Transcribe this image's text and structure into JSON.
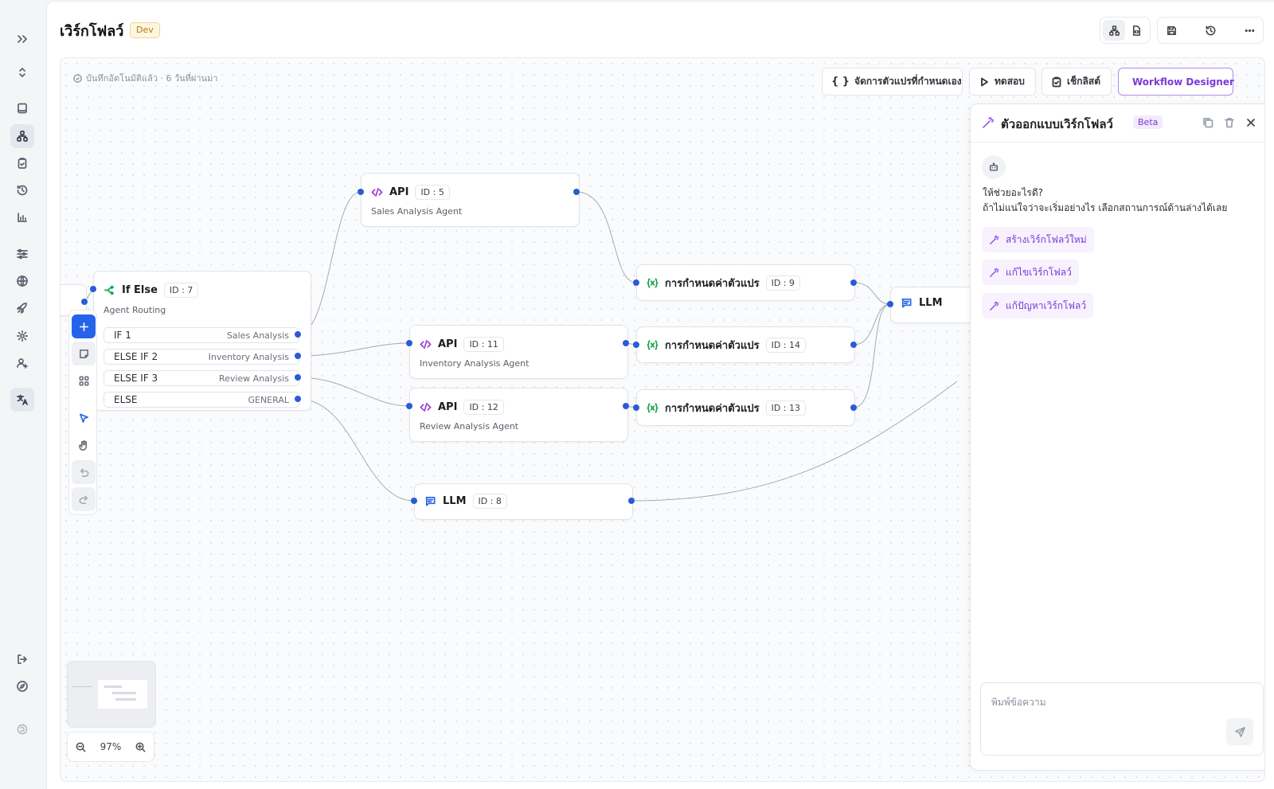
{
  "header": {
    "title": "เวิร์กโฟลว์",
    "env_badge": "Dev"
  },
  "canvas": {
    "autosave_text": "บันทึกอัตโนมัติแล้ว · 6 วันที่ผ่านมา",
    "buttons": {
      "variables": "จัดการตัวแปรที่กำหนดเอง",
      "test": "ทดสอบ",
      "checklist": "เช็กลิสต์",
      "designer": "Workflow Designer"
    },
    "zoom_level": "97%"
  },
  "nodes": {
    "ifelse": {
      "title": "If Else",
      "id": "ID : 7",
      "subtitle": "Agent Routing",
      "branches": [
        {
          "label": "IF 1",
          "target": "Sales Analysis"
        },
        {
          "label": "ELSE IF 2",
          "target": "Inventory Analysis"
        },
        {
          "label": "ELSE IF 3",
          "target": "Review Analysis"
        },
        {
          "label": "ELSE",
          "target": "GENERAL"
        }
      ]
    },
    "api5": {
      "title": "API",
      "id": "ID : 5",
      "subtitle": "Sales Analysis Agent"
    },
    "api11": {
      "title": "API",
      "id": "ID : 11",
      "subtitle": "Inventory Analysis Agent"
    },
    "api12": {
      "title": "API",
      "id": "ID : 12",
      "subtitle": "Review Analysis Agent"
    },
    "llm8": {
      "title": "LLM",
      "id": "ID : 8"
    },
    "var9": {
      "title": "การกำหนดค่าตัวแปร",
      "id": "ID : 9"
    },
    "var14": {
      "title": "การกำหนดค่าตัวแปร",
      "id": "ID : 14"
    },
    "var13": {
      "title": "การกำหนดค่าตัวแปร",
      "id": "ID : 13"
    },
    "llm_partial": {
      "title": "LLM"
    }
  },
  "designer_panel": {
    "title": "ตัวออกแบบเวิร์กโฟลว์",
    "badge": "Beta",
    "help_title": "ให้ช่วยอะไรดี?",
    "help_text": "ถ้าไม่แน่ใจว่าจะเริ่มอย่างไร เลือกสถานการณ์ด้านล่างได้เลย",
    "suggestions": [
      "สร้างเวิร์กโฟลว์ใหม่",
      "แก้ไขเวิร์กโฟลว์",
      "แก้ปัญหาเวิร์กโฟลว์"
    ],
    "input_placeholder": "พิมพ์ข้อความ"
  },
  "colors": {
    "accent": "#2563eb",
    "designer_purple": "#7c3ad6",
    "api_icon": "#9b3fd1",
    "var_icon": "#16a34a",
    "llm_icon": "#2563eb",
    "ifelse_icon": "#16a34a",
    "edge": "#9ca3af"
  }
}
